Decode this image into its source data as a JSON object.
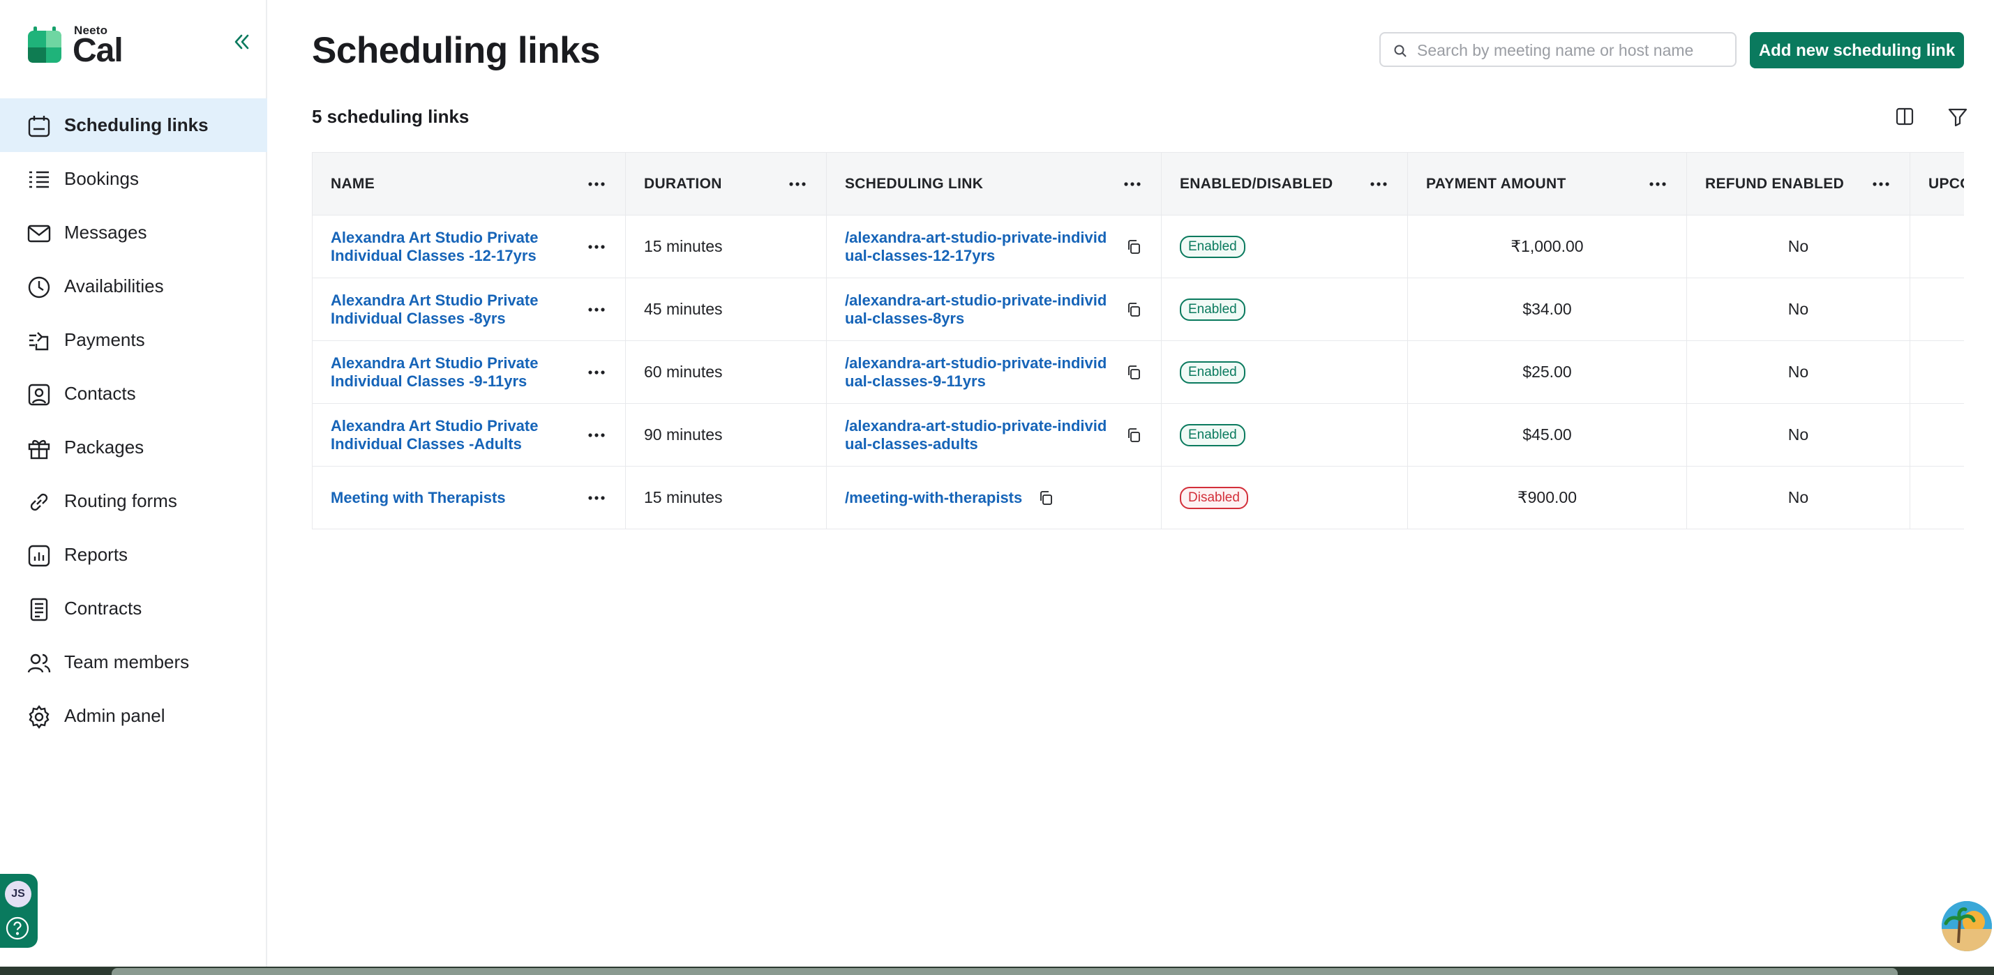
{
  "app": {
    "logo_top": "Neeto",
    "logo_bottom": "Cal",
    "brand_color": "#0a7a5e"
  },
  "sidebar": {
    "items": [
      {
        "label": "Scheduling links",
        "icon": "calendar-icon",
        "active": true
      },
      {
        "label": "Bookings",
        "icon": "list-icon",
        "active": false
      },
      {
        "label": "Messages",
        "icon": "mail-icon",
        "active": false
      },
      {
        "label": "Availabilities",
        "icon": "clock-icon",
        "active": false
      },
      {
        "label": "Payments",
        "icon": "payment-icon",
        "active": false
      },
      {
        "label": "Contacts",
        "icon": "contact-icon",
        "active": false
      },
      {
        "label": "Packages",
        "icon": "gift-icon",
        "active": false
      },
      {
        "label": "Routing forms",
        "icon": "link-icon",
        "active": false
      },
      {
        "label": "Reports",
        "icon": "chart-icon",
        "active": false
      },
      {
        "label": "Contracts",
        "icon": "document-icon",
        "active": false
      },
      {
        "label": "Team members",
        "icon": "users-icon",
        "active": false
      },
      {
        "label": "Admin panel",
        "icon": "gear-icon",
        "active": false
      }
    ],
    "user_initials": "JS"
  },
  "header": {
    "title": "Scheduling links",
    "search_placeholder": "Search by meeting name or host name",
    "add_button": "Add new scheduling link"
  },
  "summary": {
    "count_label": "5 scheduling links"
  },
  "table": {
    "columns": [
      "NAME",
      "DURATION",
      "SCHEDULING LINK",
      "ENABLED/DISABLED",
      "PAYMENT AMOUNT",
      "REFUND ENABLED",
      "UPCO"
    ],
    "rows": [
      {
        "name": "Alexandra Art Studio Private Individual Classes -12-17yrs",
        "duration": "15 minutes",
        "link": "/alexandra-art-studio-private-individual-classes-12-17yrs",
        "status": "Enabled",
        "payment": "₹1,000.00",
        "refund": "No"
      },
      {
        "name": "Alexandra Art Studio Private Individual Classes -8yrs",
        "duration": "45 minutes",
        "link": "/alexandra-art-studio-private-individual-classes-8yrs",
        "status": "Enabled",
        "payment": "$34.00",
        "refund": "No"
      },
      {
        "name": "Alexandra Art Studio Private Individual Classes -9-11yrs",
        "duration": "60 minutes",
        "link": "/alexandra-art-studio-private-individual-classes-9-11yrs",
        "status": "Enabled",
        "payment": "$25.00",
        "refund": "No"
      },
      {
        "name": "Alexandra Art Studio Private Individual Classes -Adults",
        "duration": "90 minutes",
        "link": "/alexandra-art-studio-private-individual-classes-adults",
        "status": "Enabled",
        "payment": "$45.00",
        "refund": "No"
      },
      {
        "name": "Meeting with Therapists",
        "duration": "15 minutes",
        "link": "/meeting-with-therapists",
        "status": "Disabled",
        "payment": "₹900.00",
        "refund": "No"
      }
    ]
  }
}
